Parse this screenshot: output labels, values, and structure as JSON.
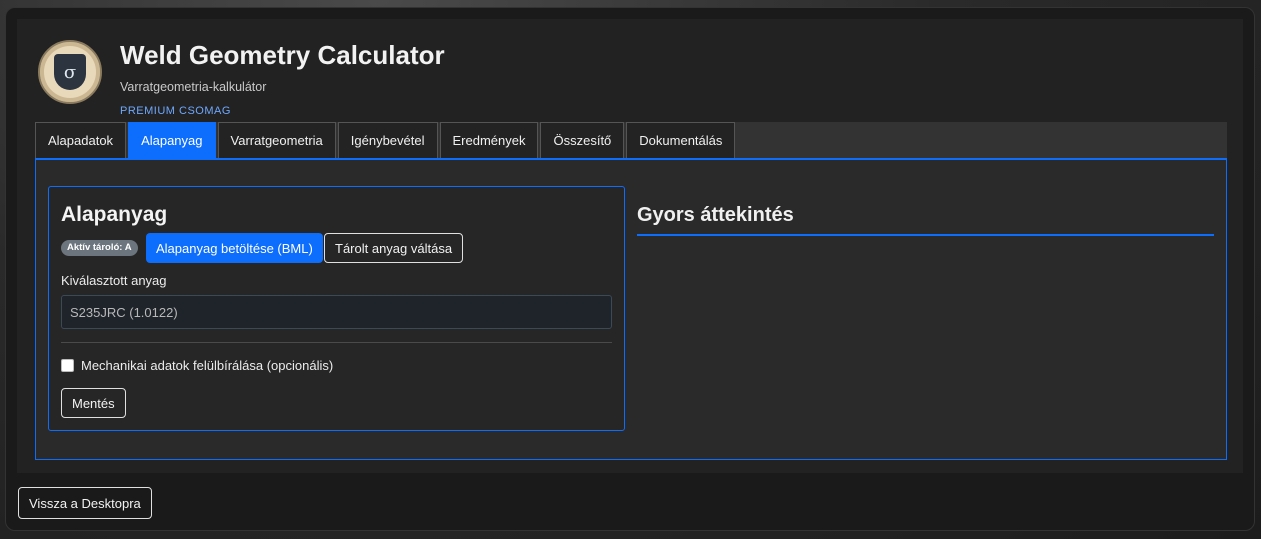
{
  "header": {
    "title": "Weld Geometry Calculator",
    "subtitle": "Varratgeometria-kalkulátor",
    "tier": "PREMIUM CSOMAG",
    "logo_icon": "sigma-shield-icon"
  },
  "tabs": [
    {
      "label": "Alapadatok",
      "active": false
    },
    {
      "label": "Alapanyag",
      "active": true
    },
    {
      "label": "Varratgeometria",
      "active": false
    },
    {
      "label": "Igénybevétel",
      "active": false
    },
    {
      "label": "Eredmények",
      "active": false
    },
    {
      "label": "Összesítő",
      "active": false
    },
    {
      "label": "Dokumentálás",
      "active": false
    }
  ],
  "material": {
    "title": "Alapanyag",
    "badge": "Aktív tároló: A",
    "load_button": "Alapanyag betöltése (BML)",
    "switch_button": "Tárolt anyag váltása",
    "selected_label": "Kiválasztott anyag",
    "selected_value": "S235JRC (1.0122)",
    "override_label": "Mechanikai adatok felülbírálása (opcionális)",
    "override_checked": false,
    "save_button": "Mentés"
  },
  "overview": {
    "title": "Gyors áttekintés"
  },
  "footer": {
    "back_button": "Vissza a Desktopra"
  },
  "colors": {
    "accent": "#0d6efd",
    "tier": "#6ea8fe",
    "badge": "#6c757d"
  }
}
